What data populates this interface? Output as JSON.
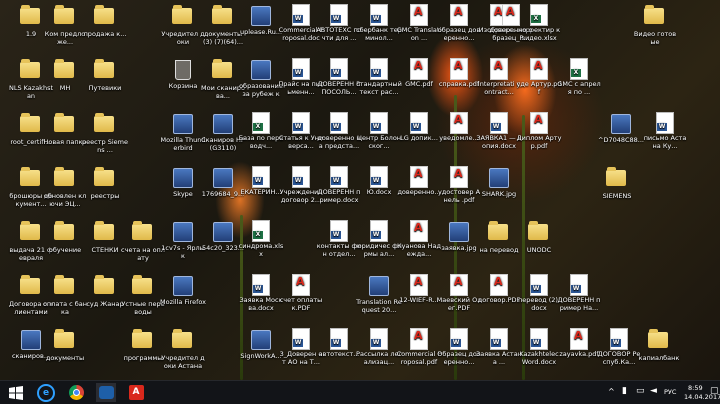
{
  "icons": [
    {
      "label": "1.9",
      "type": "folder"
    },
    {
      "label": "Ком предложе...",
      "type": "folder"
    },
    {
      "label": "продажа к...",
      "type": "folder"
    },
    {
      "label": "Учредител доки",
      "type": "folder"
    },
    {
      "label": "документы (3) (7)(64)...",
      "type": "folder"
    },
    {
      "label": "uplease.Ru...",
      "type": "app"
    },
    {
      "label": "Commercial Proposal.doc",
      "type": "word"
    },
    {
      "label": "АВТОТЕХС почти для ...",
      "type": "word"
    },
    {
      "label": "сбербанк терминол...",
      "type": "word"
    },
    {
      "label": "GMC Translation ...",
      "type": "pdf"
    },
    {
      "label": "образец доверенно...",
      "type": "pdf"
    },
    {
      "label": "Изображе...",
      "type": "pdf"
    },
    {
      "label": "корректир к видео.xlsx",
      "type": "excel"
    },
    {
      "label": "Видео готовые",
      "type": "folder"
    },
    {
      "label": "NLS Kazakhstan",
      "type": "folder"
    },
    {
      "label": "МН",
      "type": "folder"
    },
    {
      "label": "Путевики",
      "type": "folder"
    },
    {
      "label": "Корзина",
      "type": "bin"
    },
    {
      "label": "Мои сканирова...",
      "type": "folder"
    },
    {
      "label": "образование за рубеж ко...",
      "type": "app"
    },
    {
      "label": "Прайс на письменн...",
      "type": "word"
    },
    {
      "label": "ДОВЕРЕНН В ПОСОЛЬ...",
      "type": "word"
    },
    {
      "label": "стандартный текст рас...",
      "type": "word"
    },
    {
      "label": "GMC.pdf",
      "type": "pdf"
    },
    {
      "label": "справка.pdf",
      "type": "pdf"
    },
    {
      "label": "Interpretati contract...",
      "type": "pdf"
    },
    {
      "label": "уде Артур.pdf",
      "type": "pdf"
    },
    {
      "label": "GMC с апреля по ...",
      "type": "excel"
    },
    {
      "label": "root_certifi...",
      "type": "folder"
    },
    {
      "label": "Новая папка",
      "type": "folder"
    },
    {
      "label": "реестр Siemens ...",
      "type": "folder"
    },
    {
      "label": "Mozilla Thunderbird",
      "type": "app"
    },
    {
      "label": "Сканиров HP (G3110)",
      "type": "app"
    },
    {
      "label": "База по переводч...",
      "type": "excel"
    },
    {
      "label": "Статья к Универса...",
      "type": "word"
    },
    {
      "label": "доверенно на предста...",
      "type": "word"
    },
    {
      "label": "Центр Болонског...",
      "type": "word"
    },
    {
      "label": "LG допик...",
      "type": "word"
    },
    {
      "label": "уведомле...",
      "type": "pdf"
    },
    {
      "label": "ЗАЯВКА1 — копия.docx",
      "type": "word"
    },
    {
      "label": "Диплом Артур.pdf",
      "type": "pdf"
    },
    {
      "label": "^D7048C88...",
      "type": "app"
    },
    {
      "label": "письмо Астана Ку...",
      "type": "word"
    },
    {
      "label": "брошюры документ...",
      "type": "folder"
    },
    {
      "label": "обновлен ключи ЭЦ...",
      "type": "folder"
    },
    {
      "label": "реестры",
      "type": "folder"
    },
    {
      "label": "Skype",
      "type": "app"
    },
    {
      "label": "1769684_9...",
      "type": "app"
    },
    {
      "label": "ЕКАТЕРИН...",
      "type": "word"
    },
    {
      "label": "Учреждение договор 2...",
      "type": "word"
    },
    {
      "label": "ДОВЕРЕНН пример.docx",
      "type": "word"
    },
    {
      "label": "Ю.docx",
      "type": "word"
    },
    {
      "label": "доверенно...",
      "type": "pdf"
    },
    {
      "label": "удостовер Анель .pdf",
      "type": "pdf"
    },
    {
      "label": "SHARK.jpg",
      "type": "app"
    },
    {
      "label": "SIEMENS",
      "type": "folder"
    },
    {
      "label": "выдача 21 февраля",
      "type": "folder"
    },
    {
      "label": "обучение",
      "type": "folder"
    },
    {
      "label": "СТЕНКИ",
      "type": "folder"
    },
    {
      "label": "счета на оплату",
      "type": "folder"
    },
    {
      "label": "1cv7s - Ярлык",
      "type": "app"
    },
    {
      "label": "54c20_323...",
      "type": "app"
    },
    {
      "label": "синдрома.xlsx",
      "type": "excel"
    },
    {
      "label": "контакты фин отдел...",
      "type": "word"
    },
    {
      "label": "юридичес фирмы ал...",
      "type": "word"
    },
    {
      "label": "Куанова Надежда...",
      "type": "pdf"
    },
    {
      "label": "заявка.jpg",
      "type": "app"
    },
    {
      "label": "на перевод",
      "type": "folder"
    },
    {
      "label": "UNODC",
      "type": "folder"
    },
    {
      "label": "Договора с клиентами",
      "type": "folder"
    },
    {
      "label": "оплата с банка",
      "type": "folder"
    },
    {
      "label": "суд Жанар",
      "type": "folder"
    },
    {
      "label": "Устные переводы",
      "type": "folder"
    },
    {
      "label": "Mozilla Firefox",
      "type": "app"
    },
    {
      "label": "Заявка Москва.docx",
      "type": "word"
    },
    {
      "label": "счет оплаты к.PDF",
      "type": "pdf"
    },
    {
      "label": "Translation Request 20...",
      "type": "app"
    },
    {
      "label": "12-WIEF-R...",
      "type": "pdf"
    },
    {
      "label": "Маевский Олег.PDF",
      "type": "pdf"
    },
    {
      "label": "договор.PDF",
      "type": "pdf"
    },
    {
      "label": "перевод (2).docx",
      "type": "word"
    },
    {
      "label": "ДОВЕРЕНН пример На...",
      "type": "word"
    },
    {
      "label": "сканиров...",
      "type": "app"
    },
    {
      "label": "документы",
      "type": "folder"
    },
    {
      "label": "программы",
      "type": "folder"
    },
    {
      "label": "Учредител доки Астана",
      "type": "folder"
    },
    {
      "label": "SignWorkA...",
      "type": "app"
    },
    {
      "label": "3_Доверен от АО на Т...",
      "type": "word"
    },
    {
      "label": "автотекст...",
      "type": "word"
    },
    {
      "label": "Рассылка легализац...",
      "type": "word"
    },
    {
      "label": "Commercial Proposal.pdf",
      "type": "pdf"
    },
    {
      "label": "Образец доверенно...",
      "type": "word"
    },
    {
      "label": "Заявка Астана ...",
      "type": "word"
    },
    {
      "label": "Kazakhtelec Word.docx",
      "type": "word"
    },
    {
      "label": "zayavka.pdf",
      "type": "pdf"
    },
    {
      "label": "ДОГОВОР Респуб.Ка...",
      "type": "word"
    },
    {
      "label": "капиалбанк",
      "type": "folder"
    },
    {
      "label": "доверенно образец_Р...",
      "type": "pdf"
    }
  ],
  "taskbar": {
    "tray_lang": "РУС",
    "time": "8:59",
    "date": "14.04.2017"
  }
}
